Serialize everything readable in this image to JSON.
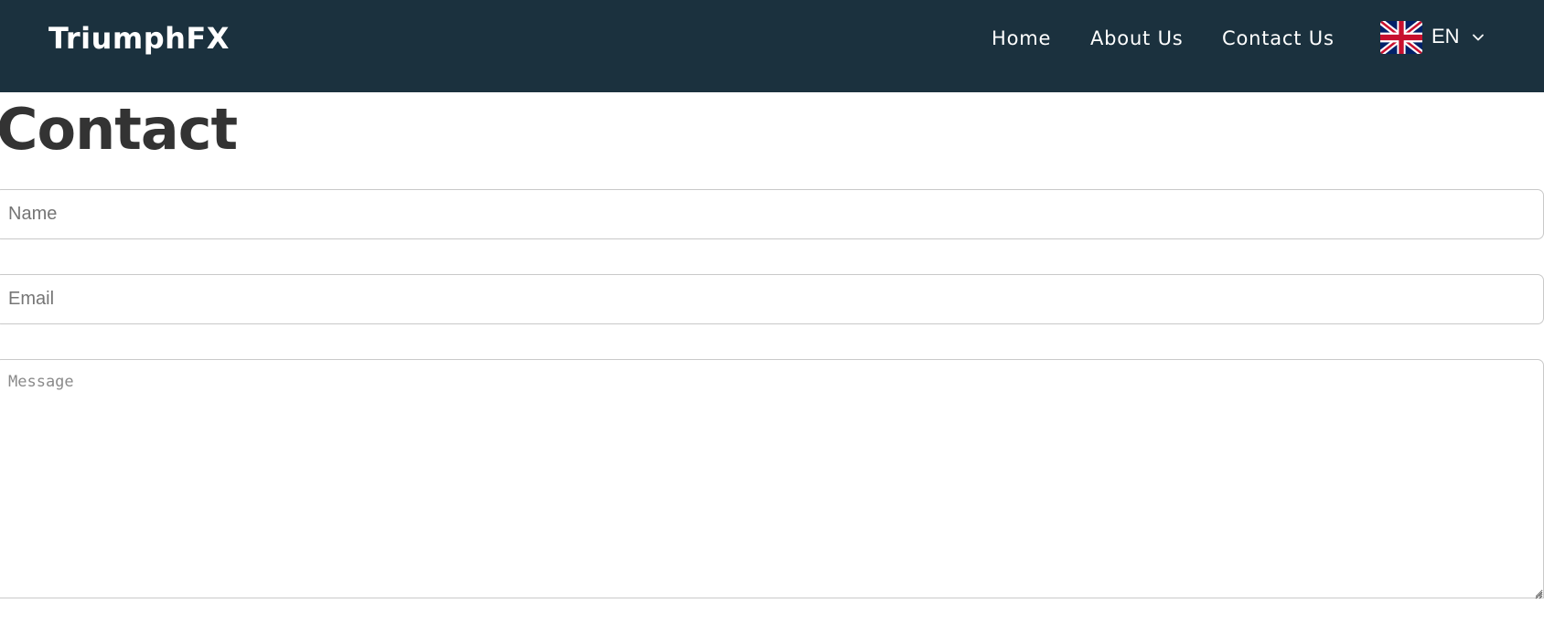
{
  "header": {
    "brand": "TriumphFX",
    "nav": {
      "home": "Home",
      "about": "About Us",
      "contact": "Contact Us"
    },
    "language": {
      "code": "EN",
      "flag_icon": "uk-flag-icon",
      "dropdown_icon": "chevron-down-icon"
    },
    "background_color": "#1b313e"
  },
  "main": {
    "title": "Contact",
    "form": {
      "name_placeholder": "Name",
      "email_placeholder": "Email",
      "message_placeholder": "Message"
    }
  }
}
